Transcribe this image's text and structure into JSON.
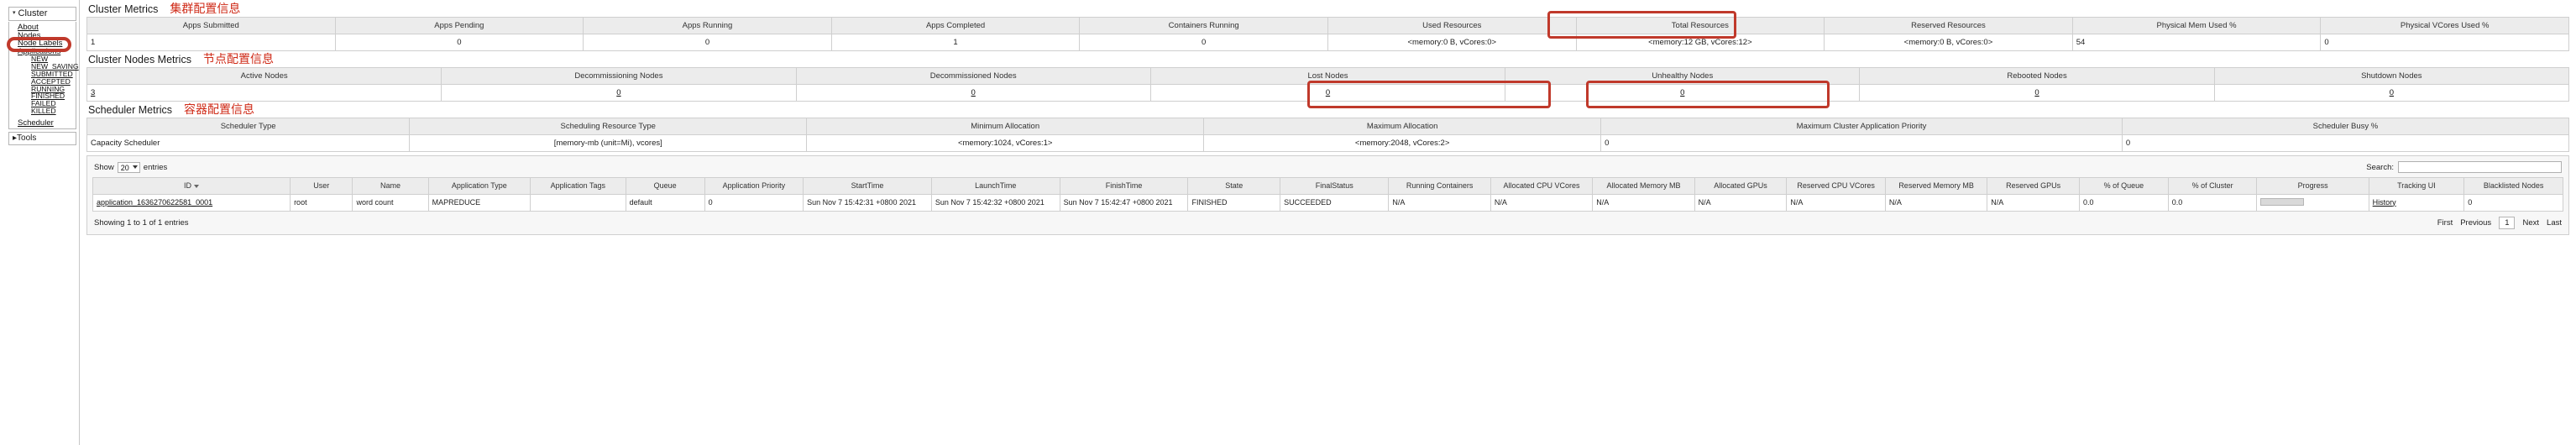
{
  "sidebar": {
    "root_label": "Cluster",
    "caret": "▾",
    "links": [
      "About",
      "Nodes",
      "Node Labels",
      "Applications"
    ],
    "app_states": [
      "NEW",
      "NEW_SAVING",
      "SUBMITTED",
      "ACCEPTED",
      "RUNNING",
      "FINISHED",
      "FAILED",
      "KILLED"
    ],
    "scheduler_label": "Scheduler",
    "tools_label": "Tools",
    "tools_caret": "▸"
  },
  "cluster_metrics": {
    "title": "Cluster Metrics",
    "note": "集群配置信息",
    "headers": [
      "Apps Submitted",
      "Apps Pending",
      "Apps Running",
      "Apps Completed",
      "Containers Running",
      "Used Resources",
      "Total Resources",
      "Reserved Resources",
      "Physical Mem Used %",
      "Physical VCores Used %"
    ],
    "values": [
      "1",
      "0",
      "0",
      "1",
      "0",
      "<memory:0 B, vCores:0>",
      "<memory:12 GB, vCores:12>",
      "<memory:0 B, vCores:0>",
      "54",
      "0"
    ]
  },
  "node_metrics": {
    "title": "Cluster Nodes Metrics",
    "note": "节点配置信息",
    "headers": [
      "Active Nodes",
      "Decommissioning Nodes",
      "Decommissioned Nodes",
      "Lost Nodes",
      "Unhealthy Nodes",
      "Rebooted Nodes",
      "Shutdown Nodes"
    ],
    "values": [
      "3",
      "0",
      "0",
      "0",
      "0",
      "0",
      "0"
    ]
  },
  "scheduler_metrics": {
    "title": "Scheduler Metrics",
    "note": "容器配置信息",
    "headers": [
      "Scheduler Type",
      "Scheduling Resource Type",
      "Minimum Allocation",
      "Maximum Allocation",
      "Maximum Cluster Application Priority",
      "Scheduler Busy %"
    ],
    "values": [
      "Capacity Scheduler",
      "[memory-mb (unit=Mi), vcores]",
      "<memory:1024, vCores:1>",
      "<memory:2048, vCores:2>",
      "0",
      "0"
    ]
  },
  "apps_panel": {
    "show_label": "Show",
    "show_value": "20",
    "entries_label": "entries",
    "search_label": "Search:",
    "search_value": "",
    "search_placeholder": "",
    "headers": [
      "ID",
      "User",
      "Name",
      "Application Type",
      "Application Tags",
      "Queue",
      "Application Priority",
      "StartTime",
      "LaunchTime",
      "FinishTime",
      "State",
      "FinalStatus",
      "Running Containers",
      "Allocated CPU VCores",
      "Allocated Memory MB",
      "Allocated GPUs",
      "Reserved CPU VCores",
      "Reserved Memory MB",
      "Reserved GPUs",
      "% of Queue",
      "% of Cluster",
      "Progress",
      "Tracking UI",
      "Blacklisted Nodes"
    ],
    "rows": [
      {
        "id": "application_1636270622581_0001",
        "user": "root",
        "name": "word count",
        "app_type": "MAPREDUCE",
        "app_tags": "",
        "queue": "default",
        "app_priority": "0",
        "start_time": "Sun Nov 7 15:42:31 +0800 2021",
        "launch_time": "Sun Nov 7 15:42:32 +0800 2021",
        "finish_time": "Sun Nov 7 15:42:47 +0800 2021",
        "state": "FINISHED",
        "final_status": "SUCCEEDED",
        "running_containers": "N/A",
        "alloc_cpu_vcores": "N/A",
        "alloc_memory_mb": "N/A",
        "alloc_gpus": "N/A",
        "res_cpu_vcores": "N/A",
        "res_memory_mb": "N/A",
        "res_gpus": "N/A",
        "pct_queue": "0.0",
        "pct_cluster": "0.0",
        "progress": "",
        "tracking_ui": "History",
        "blacklisted_nodes": "0"
      }
    ],
    "summary": "Showing 1 to 1 of 1 entries",
    "pager": {
      "first": "First",
      "previous": "Previous",
      "current": "1",
      "next": "Next",
      "last": "Last"
    }
  },
  "colors": {
    "annotation_red": "#c0392b",
    "note_red": "#cf2a17",
    "header_bg": "#ececec"
  }
}
